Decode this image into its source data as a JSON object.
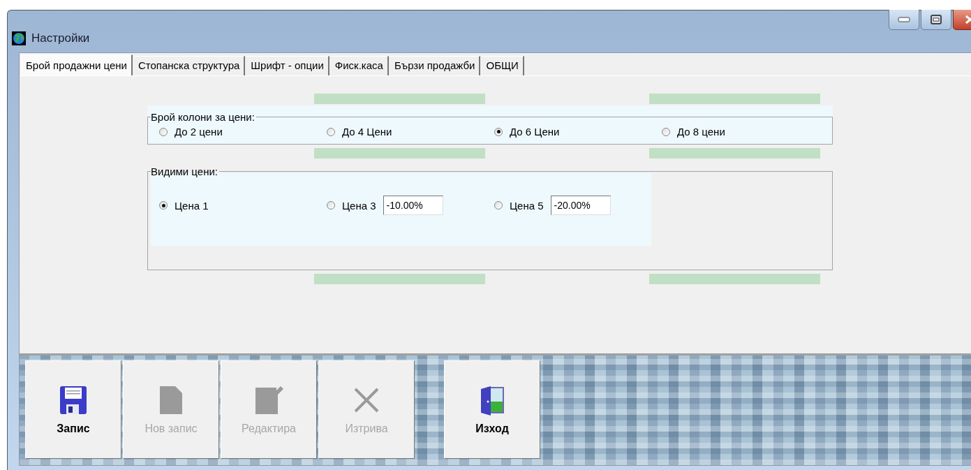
{
  "window": {
    "title": "Настройки"
  },
  "tabs": [
    {
      "label": "Брой продажни цени",
      "selected": true
    },
    {
      "label": "Стопанска структура",
      "selected": false
    },
    {
      "label": "Шрифт - опции",
      "selected": false
    },
    {
      "label": "Фиск.каса",
      "selected": false
    },
    {
      "label": "Бързи продажби",
      "selected": false
    },
    {
      "label": "ОБЩИ",
      "selected": false
    }
  ],
  "price_columns": {
    "legend": "Брой колони за цени:",
    "options": [
      {
        "label": "До 2 цени",
        "selected": false
      },
      {
        "label": "До 4 Цени",
        "selected": false
      },
      {
        "label": "До 6 Цени",
        "selected": true
      },
      {
        "label": "До 8 цени",
        "selected": false
      }
    ]
  },
  "visible_prices": {
    "legend": "Видими цени:",
    "options": [
      {
        "label": "Цена 1",
        "selected": true
      },
      {
        "label": "Цена 3",
        "selected": false,
        "value": "-10.00%"
      },
      {
        "label": "Цена 5",
        "selected": false,
        "value": "-20.00%"
      }
    ]
  },
  "toolbar": [
    {
      "kind": "save",
      "label": "Запис",
      "disabled": false
    },
    {
      "kind": "new",
      "label": "Нов запис",
      "disabled": true
    },
    {
      "kind": "edit",
      "label": "Редактира",
      "disabled": true
    },
    {
      "kind": "delete",
      "label": "Изтрива",
      "disabled": true
    },
    {
      "kind": "exit",
      "label": "Изход",
      "disabled": false
    }
  ]
}
